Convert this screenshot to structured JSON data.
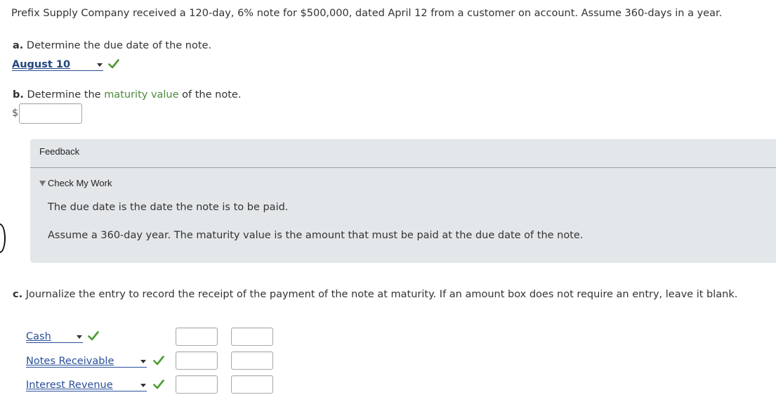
{
  "problem_statement": "Prefix Supply Company received a 120-day, 6% note for $500,000, dated April 12 from a customer on account. Assume 360-days in a year.",
  "part_a": {
    "letter": "a.",
    "question": "Determine the due date of the note.",
    "answer_select": "August 10"
  },
  "part_b": {
    "letter": "b.",
    "question_prefix": "Determine the",
    "question_term": "maturity value",
    "question_suffix": "of the note.",
    "currency_symbol": "$",
    "amount_value": ""
  },
  "feedback": {
    "title": "Feedback",
    "toggle_label": "Check My Work",
    "hints": [
      "The due date is the date the note is to be paid.",
      "Assume a 360-day year. The maturity value is the amount that must be paid at the due date of the note."
    ]
  },
  "part_c": {
    "letter": "c.",
    "instruction": "Journalize the entry to record the receipt of the payment of the note at maturity. If an amount box does not require an entry, leave it blank.",
    "rows": [
      {
        "account": "Cash",
        "debit": "",
        "credit": ""
      },
      {
        "account": "Notes Receivable",
        "debit": "",
        "credit": ""
      },
      {
        "account": "Interest Revenue",
        "debit": "",
        "credit": ""
      }
    ]
  },
  "icons": {
    "correct_check": "check-icon",
    "dropdown_arrow": "caret-down-icon",
    "expand_triangle": "triangle-down-icon"
  },
  "colors": {
    "check_green": "#4e9a2f",
    "link_blue": "#2a4f99",
    "term_green": "#4a8a3a",
    "feedback_bg": "#e3e7ea"
  }
}
